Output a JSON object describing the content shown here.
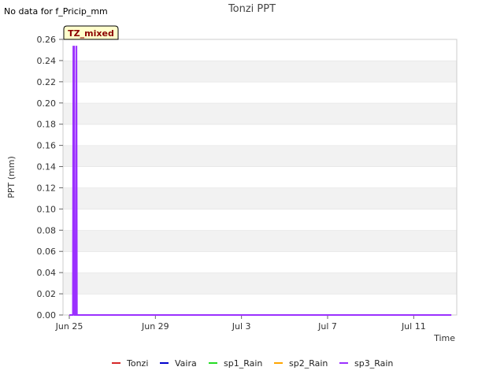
{
  "notice": "No data for f_Pricip_mm",
  "badge": "TZ_mixed",
  "chart_data": {
    "type": "line",
    "title": "Tonzi PPT",
    "xlabel": "Time",
    "ylabel": "PPT (mm)",
    "ylim": [
      0,
      0.26
    ],
    "yticks": [
      0.0,
      0.02,
      0.04,
      0.06,
      0.08,
      0.1,
      0.12,
      0.14,
      0.16,
      0.18,
      0.2,
      0.22,
      0.24,
      0.26
    ],
    "xlim": [
      "2024-06-25",
      "2024-07-13"
    ],
    "xticks": [
      {
        "date": "2024-06-25",
        "label": "Jun 25"
      },
      {
        "date": "2024-06-29",
        "label": "Jun 29"
      },
      {
        "date": "2024-07-03",
        "label": "Jul 3"
      },
      {
        "date": "2024-07-07",
        "label": "Jul 7"
      },
      {
        "date": "2024-07-11",
        "label": "Jul 11"
      }
    ],
    "grid": "horizontal bands",
    "legend_position": "bottom",
    "series": [
      {
        "name": "Tonzi",
        "color": "#d62728",
        "points": []
      },
      {
        "name": "Vaira",
        "color": "#0000cc",
        "points": []
      },
      {
        "name": "sp1_Rain",
        "color": "#22dd22",
        "points": []
      },
      {
        "name": "sp2_Rain",
        "color": "#ffa500",
        "points": []
      },
      {
        "name": "sp3_Rain",
        "color": "#9b30ff",
        "points": [
          [
            "2024-06-25T00:00",
            0
          ],
          [
            "2024-06-25T04:00",
            0
          ],
          [
            "2024-06-25T04:30",
            0.254
          ],
          [
            "2024-06-25T05:00",
            0
          ],
          [
            "2024-06-25T05:30",
            0.254
          ],
          [
            "2024-06-25T06:00",
            0
          ],
          [
            "2024-06-25T07:30",
            0
          ],
          [
            "2024-06-25T08:00",
            0.254
          ],
          [
            "2024-06-25T08:30",
            0
          ],
          [
            "2024-07-12T18:00",
            0
          ]
        ]
      }
    ]
  }
}
